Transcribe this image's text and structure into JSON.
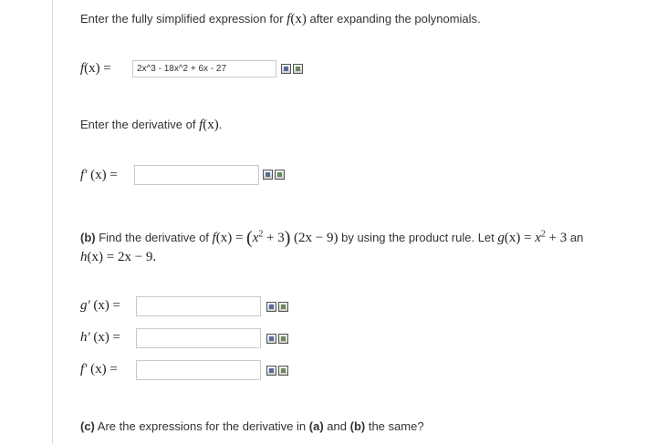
{
  "intro": {
    "text": "Enter the fully simplified expression for",
    "func": "f",
    "var": "(x)",
    "tail": "after expanding the polynomials."
  },
  "f_field": {
    "lhs_func": "f",
    "lhs_var": "(x)",
    "eq": "=",
    "value": "2x^3 - 18x^2 + 6x - 27"
  },
  "derivative_prompt": {
    "text": "Enter the derivative of",
    "func": "f",
    "var": "(x)",
    "tail": "."
  },
  "fprime_field": {
    "lhs": "f′",
    "lhs_var": "(x)",
    "eq": "=",
    "value": ""
  },
  "part_b": {
    "label": "(b)",
    "text1": "Find the derivative of",
    "f": "f",
    "fx": "(x) =",
    "lp": "(",
    "x": "x",
    "exp": "2",
    "plus3": "+ 3",
    "rp": ")",
    "factor2": "(2x − 9)",
    "text2": "by using the product rule. Let",
    "g": "g",
    "gx": "(x) =",
    "gx2": "x",
    "gexp": "2",
    "g3": "+ 3",
    "an": "an",
    "h": "h",
    "hx": "(x) = 2x − 9."
  },
  "part_b_fields": [
    {
      "lhs": "g′",
      "var": "(x)",
      "eq": "=",
      "value": ""
    },
    {
      "lhs": "h′",
      "var": "(x)",
      "eq": "=",
      "value": ""
    },
    {
      "lhs": "f′",
      "var": "(x)",
      "eq": "=",
      "value": ""
    }
  ],
  "part_c": {
    "label": "(c)",
    "text": "Are the expressions for the derivative in",
    "a": "(a)",
    "and": "and",
    "b": "(b)",
    "tail": "the same?"
  },
  "icons": {
    "preview": "preview-icon",
    "answer": "answer-format-icon"
  }
}
